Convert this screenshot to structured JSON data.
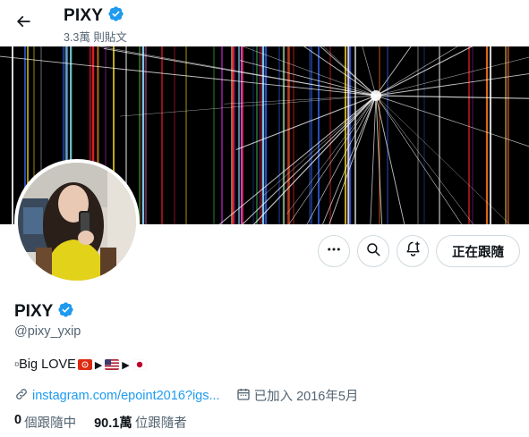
{
  "header": {
    "title": "PIXY",
    "post_count": "3.3萬 則貼文",
    "back_icon": "arrow-left-icon"
  },
  "profile": {
    "display_name": "PIXY",
    "handle": "@pixy_yxip",
    "verified": true,
    "verified_color": "#1d9bf0",
    "bio_prefix": "▫Big LOVE",
    "bio_flags": [
      "hong-kong-flag",
      "usa-flag",
      "japan-flag"
    ],
    "bio_separator": "▶",
    "link_text": "instagram.com/epoint2016?igs...",
    "joined": "已加入 2016年5月"
  },
  "stats": {
    "following_count": "0",
    "following_label": "個跟隨中",
    "followers_count": "90.1萬",
    "followers_label": "位跟隨者"
  },
  "actions": {
    "more_icon": "more-icon",
    "search_icon": "search-icon",
    "notify_icon": "bell-plus-icon",
    "follow_label": "正在跟隨"
  },
  "colors": {
    "accent": "#1d9bf0",
    "text": "#0f1419",
    "muted": "#536471",
    "border": "#cfd9de"
  }
}
